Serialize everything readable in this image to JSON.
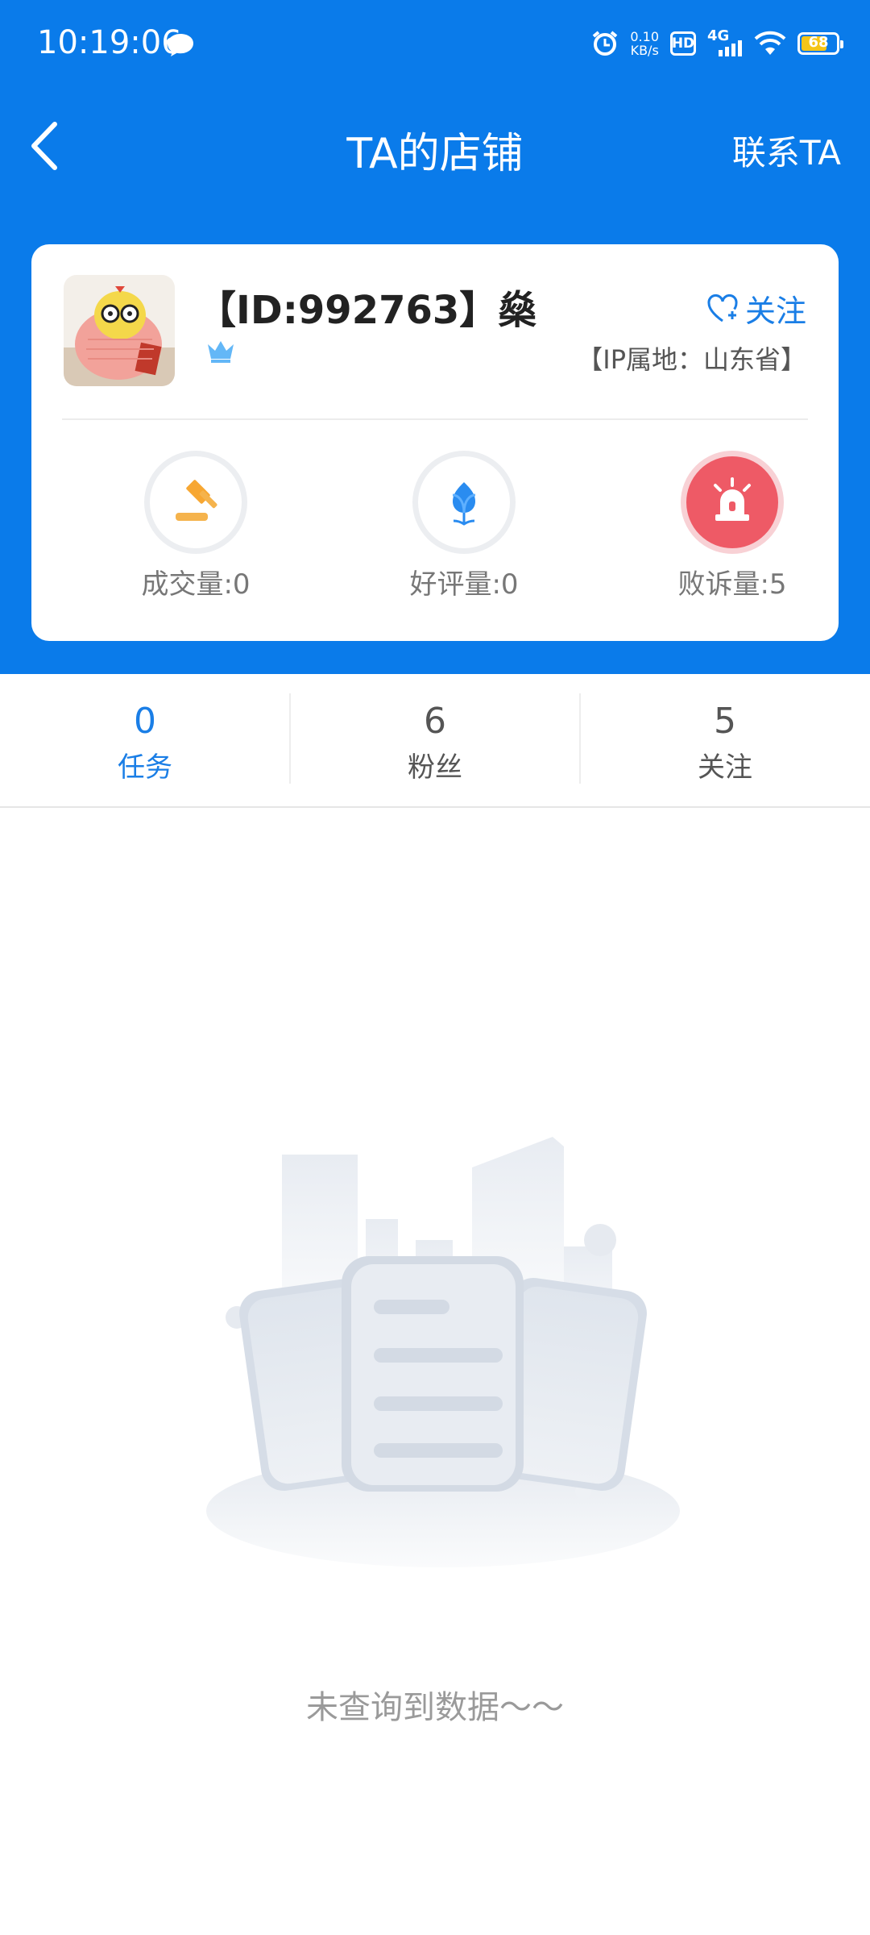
{
  "status_bar": {
    "time": "10:19:06",
    "net_speed_value": "0.10",
    "net_speed_unit": "KB/s",
    "hd_label": "HD",
    "network_type": "4G",
    "battery_level": "68"
  },
  "nav": {
    "title": "TA的店铺",
    "contact_label": "联系TA"
  },
  "shop": {
    "name": "【ID:992763】燊",
    "follow_label": "关注",
    "ip_location": "【IP属地：山东省】",
    "stats": [
      {
        "label": "成交量:0",
        "icon": "gavel-icon"
      },
      {
        "label": "好评量:0",
        "icon": "tulip-icon"
      },
      {
        "label": "败诉量:5",
        "icon": "siren-icon"
      }
    ]
  },
  "tabs": [
    {
      "count": "0",
      "label": "任务",
      "active": true
    },
    {
      "count": "6",
      "label": "粉丝",
      "active": false
    },
    {
      "count": "5",
      "label": "关注",
      "active": false
    }
  ],
  "empty_state": {
    "message": "未查询到数据～～"
  },
  "colors": {
    "primary_blue": "#0a7bea",
    "accent_blue": "#1a7ee6",
    "alert_red": "#ee5a66"
  }
}
